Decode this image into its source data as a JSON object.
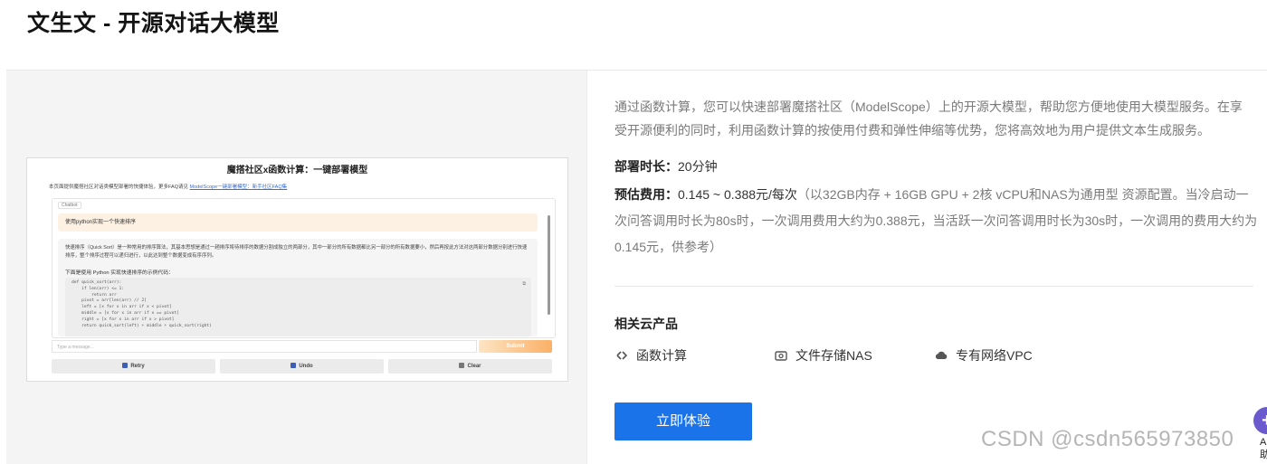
{
  "page": {
    "title": "文生文 - 开源对话大模型"
  },
  "preview": {
    "title": "魔搭社区x函数计算：一键部署模型",
    "desc": "本页面提供魔搭社区对话类模型部署的快捷体验，更多FAQ请见",
    "desc_link": "ModelScope一键部署模型：新手社区FAQ集",
    "chatbot_label": "Chatbot",
    "user_msg": "使用python实现一个快速排序",
    "bot_para1": "快速排序（Quick Sort）是一种常用的排序算法，其基本思想是通过一趟排序将待排序的数据分割成独立的两部分，其中一部分的所有数据都比另一部分的所有数据要小，然后再按此方法对这两部分数据分别进行快速排序，整个排序过程可以递归进行，以此达到整个数据变成有序序列。",
    "bot_para2": "下面是使用 Python 实现快速排序的示例代码：",
    "code": "def quick_sort(arr):\n    if len(arr) <= 1:\n        return arr\n    pivot = arr[len(arr) // 2]\n    left = [x for x in arr if x < pivot]\n    middle = [x for x in arr if x == pivot]\n    right = [x for x in arr if x > pivot]\n    return quick_sort(left) + middle + quick_sort(right)",
    "input_placeholder": "Type a message...",
    "submit_label": "Submit",
    "retry_label": "Retry",
    "undo_label": "Undo",
    "clear_label": "Clear"
  },
  "info": {
    "intro": "通过函数计算，您可以快速部署魔搭社区（ModelScope）上的开源大模型，帮助您方便地使用大模型服务。在享受开源便利的同时，利用函数计算的按使用付费和弹性伸缩等优势，您将高效地为用户提供文本生成服务。",
    "deploy_label": "部署时长：",
    "deploy_value": "20分钟",
    "cost_label": "预估费用：",
    "cost_value": "0.145 ~ 0.388元/每次",
    "cost_note": "（以32GB内存 + 16GB GPU + 2核 vCPU和NAS为通用型 资源配置。当冷启动一次问答调用时长为80s时，一次调用费用大约为0.388元，当活跃一次问答调用时长为30s时，一次调用的费用大约为0.145元，供参考）"
  },
  "products": {
    "title": "相关云产品",
    "items": [
      {
        "label": "函数计算",
        "icon": "function-compute-icon"
      },
      {
        "label": "文件存储NAS",
        "icon": "nas-storage-icon"
      },
      {
        "label": "专有网络VPC",
        "icon": "vpc-cloud-icon"
      }
    ]
  },
  "cta": {
    "label": "立即体验"
  },
  "watermark": "CSDN @csdn565973850",
  "fab": {
    "symbol": "+",
    "label": "A\n助"
  }
}
